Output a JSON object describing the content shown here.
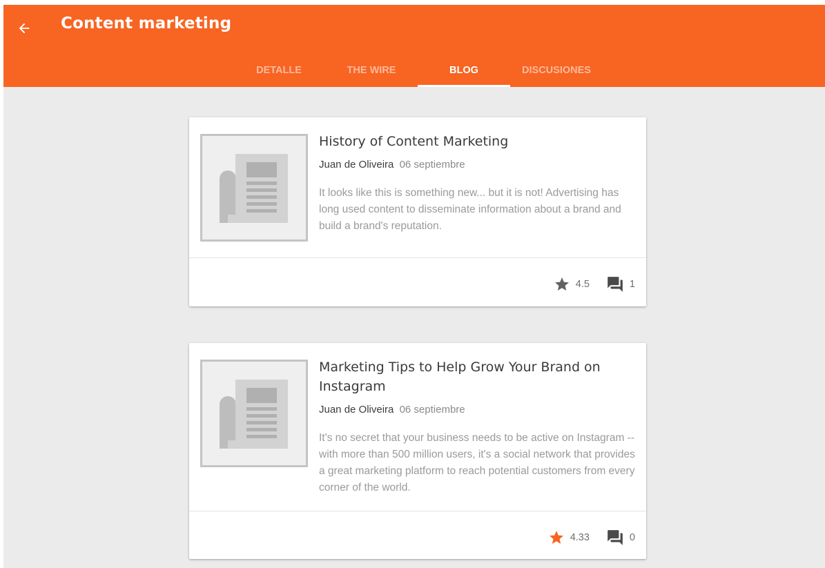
{
  "header": {
    "title": "Content marketing",
    "back_icon": "arrow-left-icon",
    "background": "#f86422"
  },
  "tabs": [
    {
      "label": "DETALLE",
      "active": false
    },
    {
      "label": "THE WIRE",
      "active": false
    },
    {
      "label": "BLOG",
      "active": true
    },
    {
      "label": "DISCUSIONES",
      "active": false
    }
  ],
  "posts": [
    {
      "title": "History of Content Marketing",
      "author": "Juan de Oliveira",
      "date": "06 septiembre",
      "excerpt": "It looks like this is something new... but it is not! Advertising has long used content to disseminate information about a brand and build a brand's reputation.",
      "rating": "4.5",
      "rating_color": "#616161",
      "comments": "1",
      "thumbnail_icon": "newspaper-icon"
    },
    {
      "title": "Marketing Tips to Help Grow Your Brand on Instagram",
      "author": "Juan de Oliveira",
      "date": "06 septiembre",
      "excerpt": "It's no secret that your business needs to be active on Instagram -- with more than 500 million users, it's a social network that provides a great marketing platform to reach potential customers from every corner of the world.",
      "rating": "4.33",
      "rating_color": "#f86422",
      "comments": "0",
      "thumbnail_icon": "newspaper-icon"
    }
  ]
}
